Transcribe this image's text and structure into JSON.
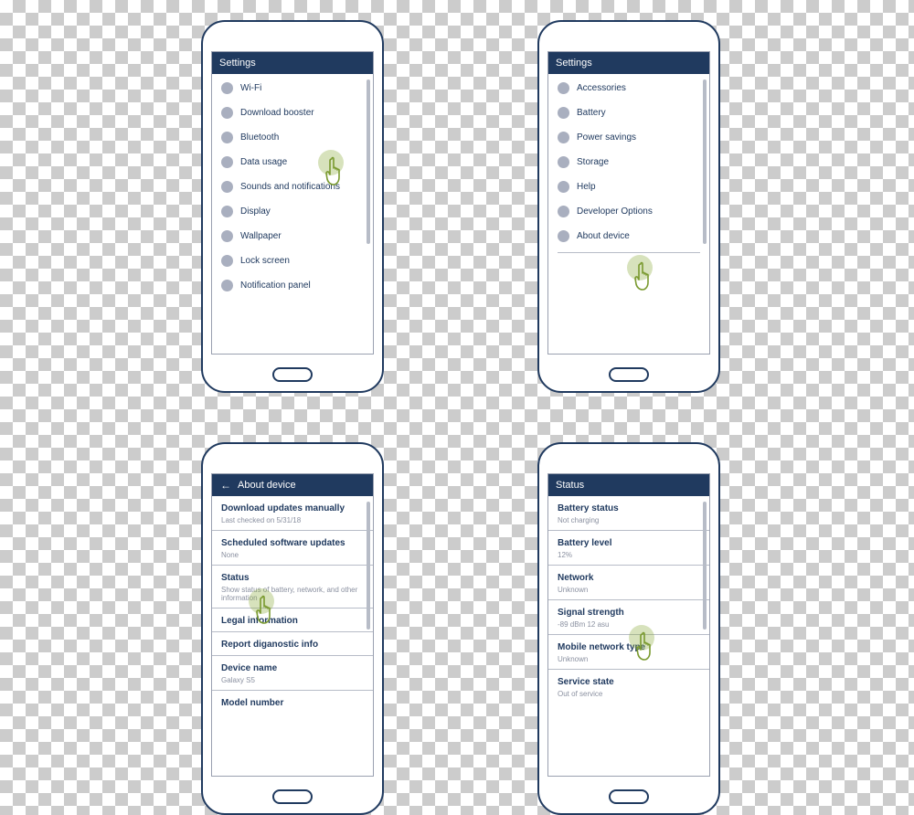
{
  "phones": {
    "p1": {
      "header": "Settings",
      "items": [
        "Wi-Fi",
        "Download booster",
        "Bluetooth",
        "Data usage",
        "Sounds and notifications",
        "Display",
        "Wallpaper",
        "Lock screen",
        "Notification panel"
      ]
    },
    "p2": {
      "header": "Settings",
      "items": [
        "Accessories",
        "Battery",
        "Power savings",
        "Storage",
        "Help",
        "Developer Options",
        "About device"
      ]
    },
    "p3": {
      "header": "About device",
      "rows": [
        {
          "title": "Download updates manually",
          "sub": "Last checked on 5/31/18"
        },
        {
          "title": "Scheduled software updates",
          "sub": "None"
        },
        {
          "title": "Status",
          "sub": "Show status of battery, network, and other information"
        },
        {
          "title": "Legal information",
          "sub": ""
        },
        {
          "title": "Report diganostic info",
          "sub": ""
        },
        {
          "title": "Device name",
          "sub": "Galaxy S5"
        },
        {
          "title": "Model number",
          "sub": ""
        }
      ]
    },
    "p4": {
      "header": "Status",
      "rows": [
        {
          "title": "Battery status",
          "sub": "Not charging"
        },
        {
          "title": "Battery level",
          "sub": "12%"
        },
        {
          "title": "Network",
          "sub": "Unknown"
        },
        {
          "title": "Signal strength",
          "sub": "-89 dBm 12 asu"
        },
        {
          "title": "Mobile network type",
          "sub": "Unknown"
        },
        {
          "title": "Service state",
          "sub": "Out of service"
        }
      ]
    }
  }
}
